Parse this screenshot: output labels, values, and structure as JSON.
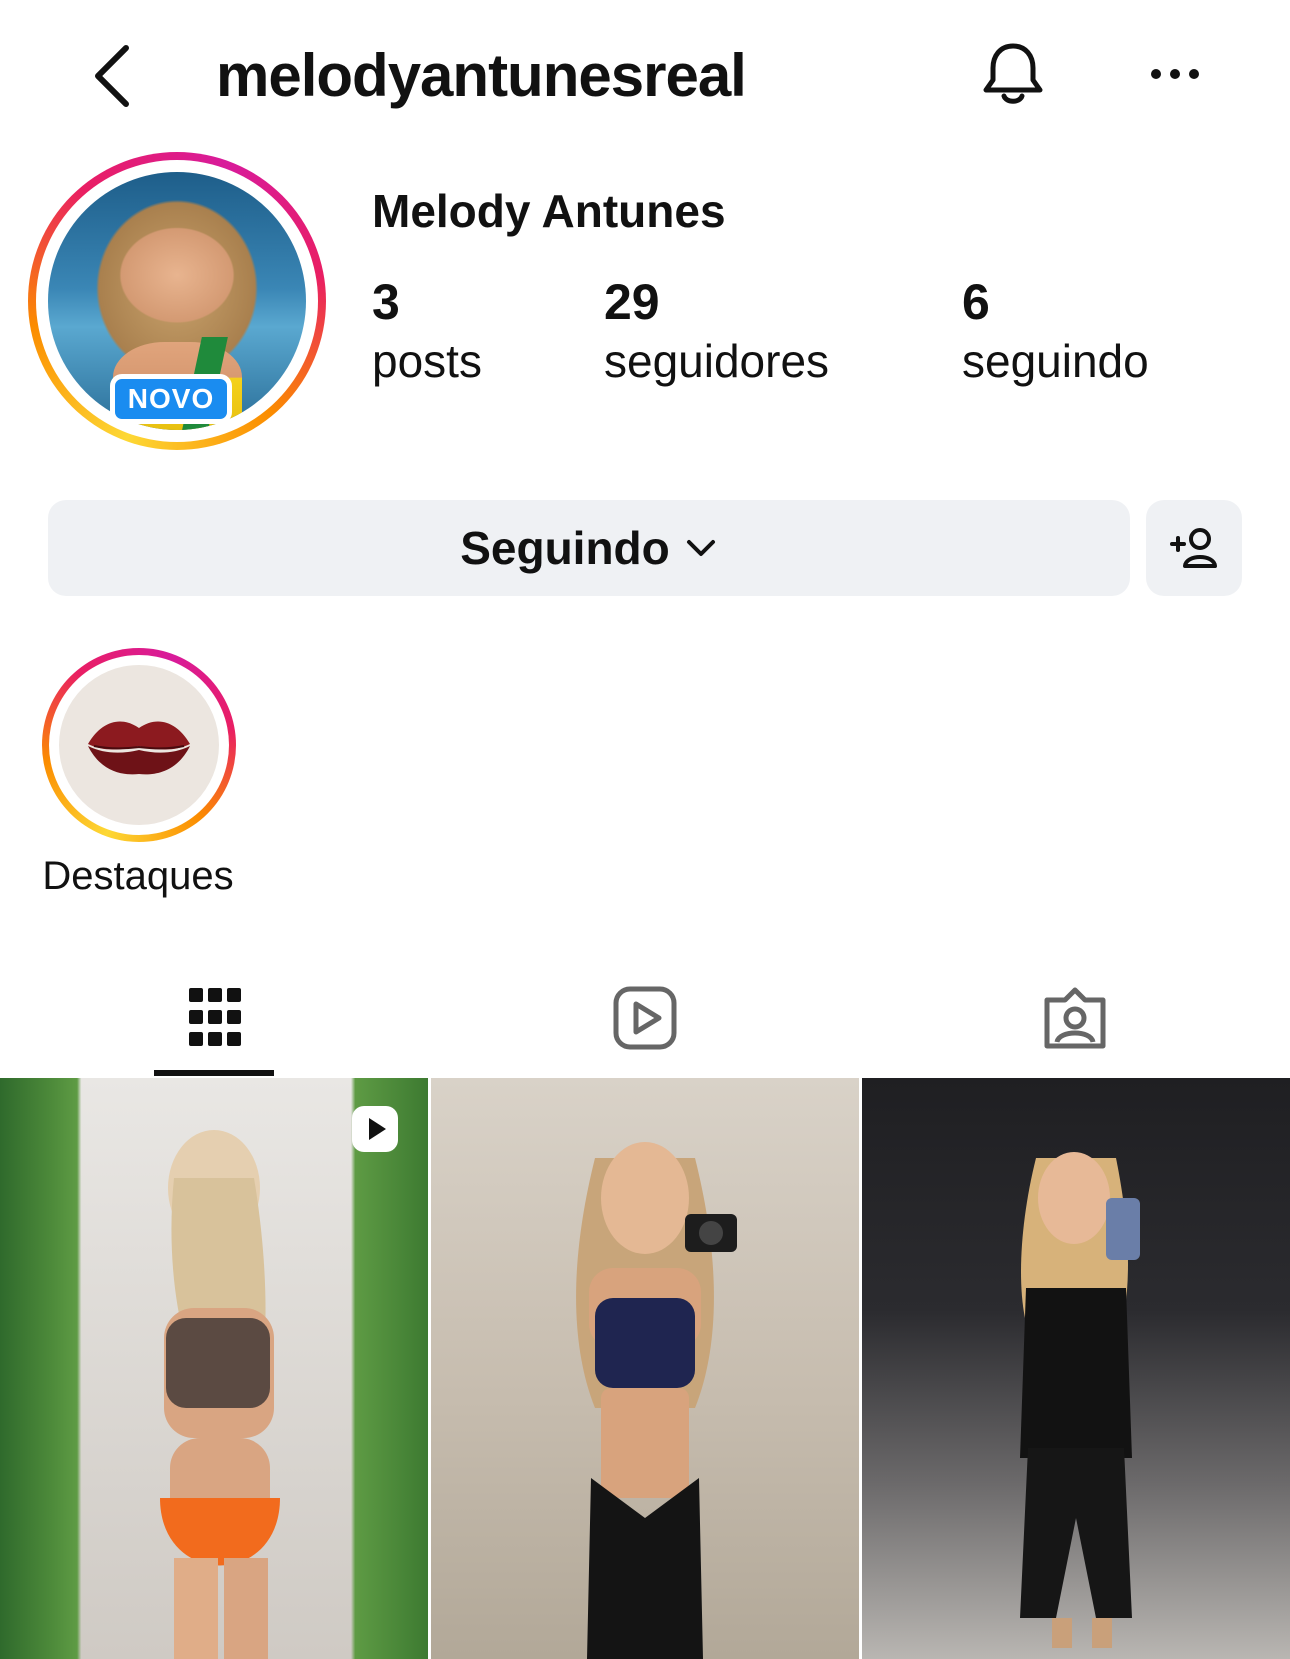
{
  "header": {
    "username": "melodyantunesreal",
    "back_icon": "chevron-left-icon",
    "notification_icon": "bell-icon",
    "more_icon": "more-horizontal-icon"
  },
  "profile": {
    "display_name": "Melody Antunes",
    "new_badge": "NOVO",
    "stats": {
      "posts": {
        "value": "3",
        "label": "posts"
      },
      "followers": {
        "value": "29",
        "label": "seguidores"
      },
      "following": {
        "value": "6",
        "label": "seguindo"
      }
    }
  },
  "actions": {
    "following_label": "Seguindo",
    "add_user_icon": "add-user-icon"
  },
  "highlights": [
    {
      "label": "Destaques"
    }
  ],
  "tabs": [
    {
      "icon": "grid-icon",
      "active": true
    },
    {
      "icon": "reels-icon",
      "active": false
    },
    {
      "icon": "tagged-icon",
      "active": false
    }
  ],
  "colors": {
    "story_ring_start": "#fdd835",
    "story_ring_end": "#d81b9b",
    "badge_blue": "#1a8cf0",
    "button_bg": "#eff1f4"
  }
}
